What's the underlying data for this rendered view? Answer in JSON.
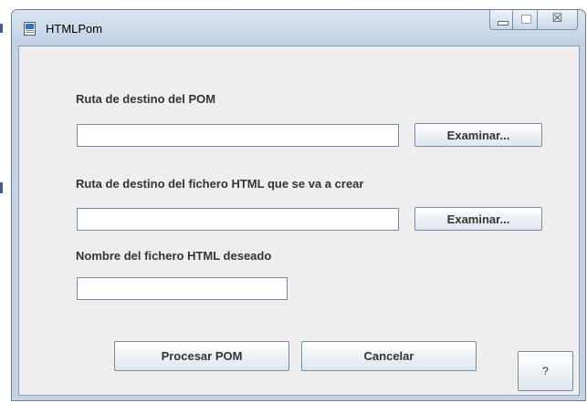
{
  "window": {
    "title": "HTMLPom",
    "close_glyph": "☒"
  },
  "form": {
    "pom_path_label": "Ruta de destino del POM",
    "pom_path_value": "",
    "html_path_label": "Ruta de destino del fichero HTML que se va a crear",
    "html_path_value": "",
    "html_name_label": "Nombre del fichero HTML deseado",
    "html_name_value": "",
    "browse_label": "Examinar..."
  },
  "actions": {
    "process_label": "Procesar POM",
    "cancel_label": "Cancelar",
    "help_label": "?"
  },
  "icons": {
    "app": "document-icon",
    "minimize": "minimize-icon",
    "maximize": "maximize-icon",
    "close": "close-icon"
  },
  "colors": {
    "frame": "#c4d3e3",
    "client_bg": "#eeeeee",
    "label_text": "#333333"
  }
}
